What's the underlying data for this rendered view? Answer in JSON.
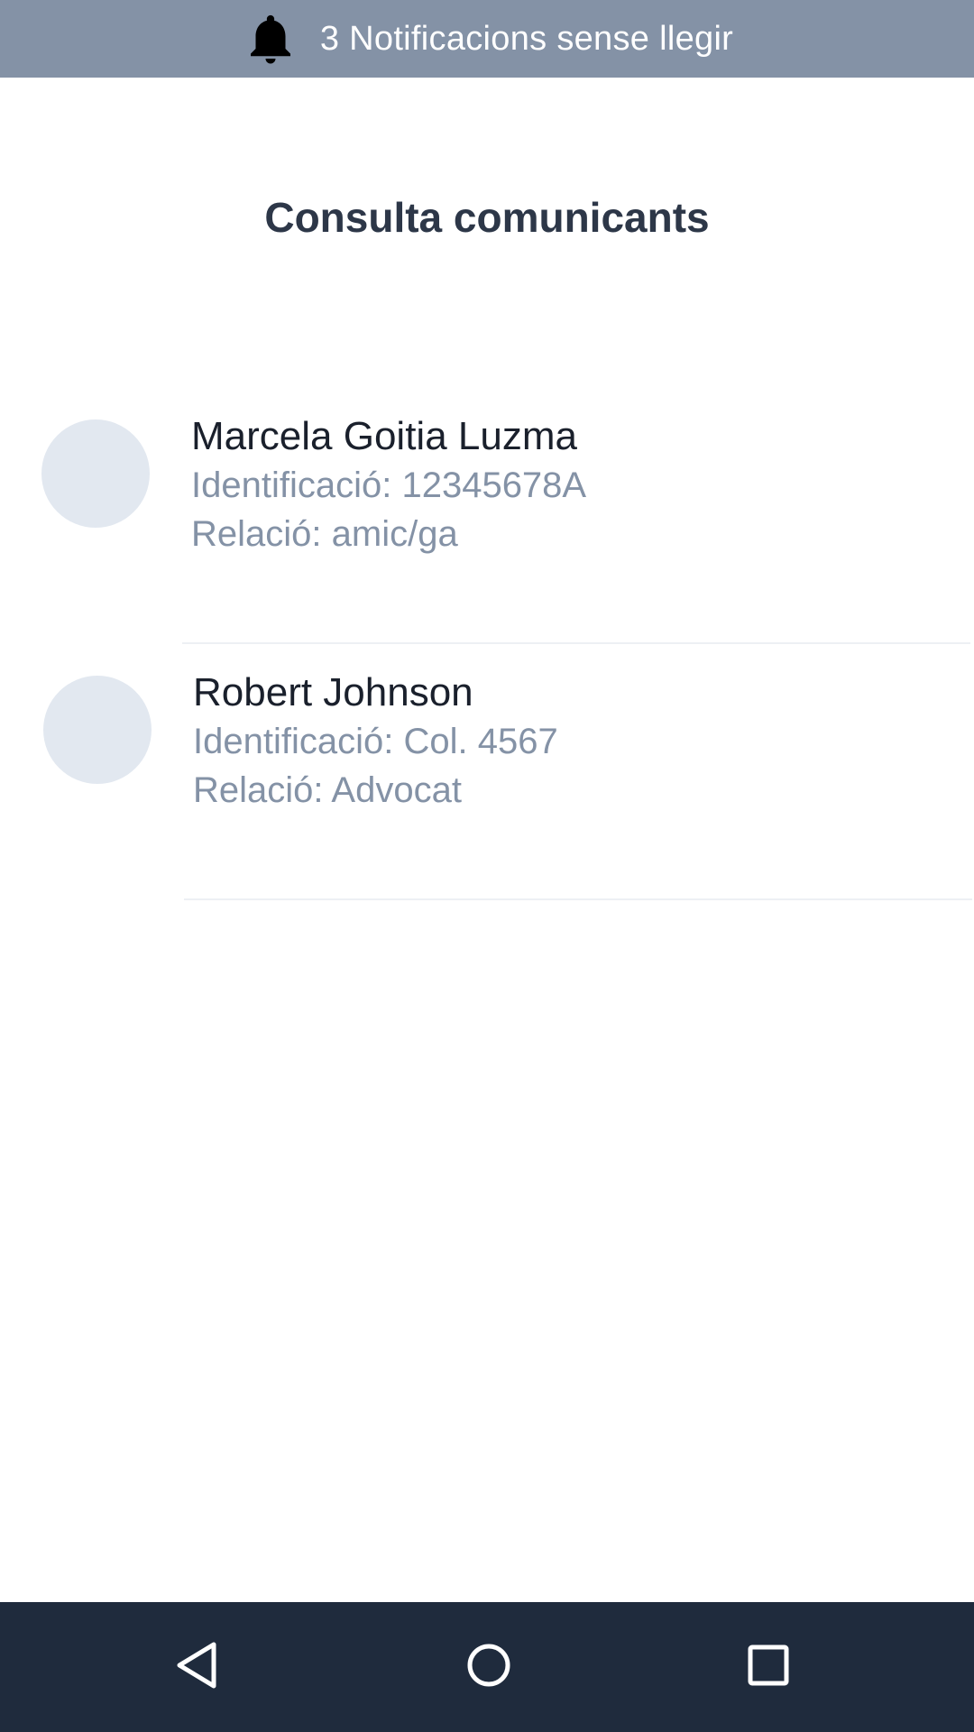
{
  "notification_bar": {
    "text": "3 Notificacions sense llegir",
    "icon": "bell-icon",
    "background": "#8492a6"
  },
  "page": {
    "title": "Consulta comunicants"
  },
  "contacts": [
    {
      "name": "Marcela Goitia Luzma",
      "identification": "Identificació: 12345678A",
      "relation": "Relació: amic/ga"
    },
    {
      "name": "Robert Johnson",
      "identification": "Identificació: Col. 4567",
      "relation": "Relació: Advocat"
    }
  ],
  "system_nav": {
    "background": "#1f2b3d",
    "buttons": [
      "back-icon",
      "home-icon",
      "recents-icon"
    ]
  }
}
